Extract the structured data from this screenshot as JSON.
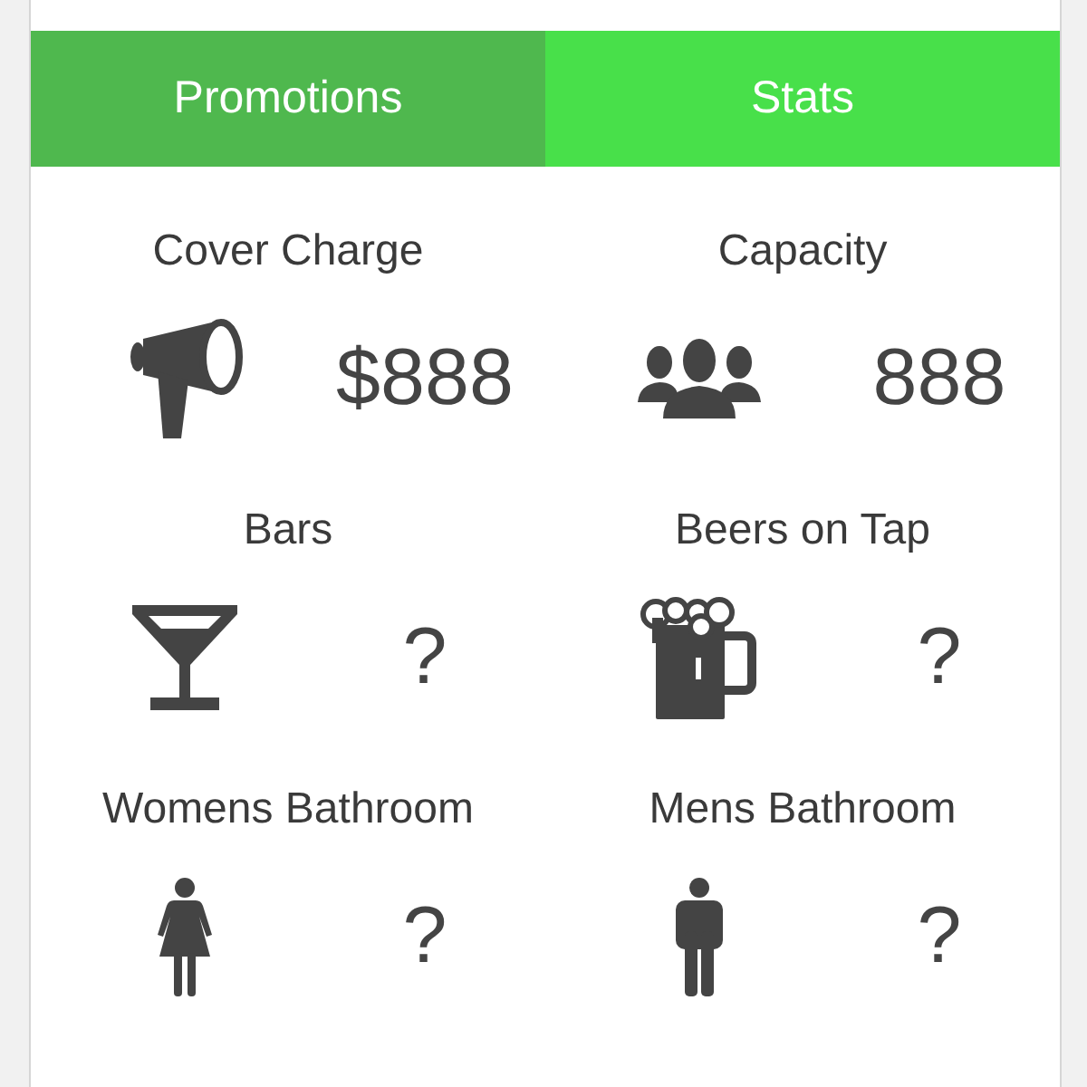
{
  "tabs": [
    {
      "label": "Promotions",
      "selected": false
    },
    {
      "label": "Stats",
      "selected": true
    }
  ],
  "stats": [
    {
      "label": "Cover Charge",
      "value": "$888"
    },
    {
      "label": "Capacity",
      "value": "888"
    },
    {
      "label": "Bars",
      "value": "?"
    },
    {
      "label": "Beers on Tap",
      "value": "?"
    },
    {
      "label": "Womens Bathroom",
      "value": "?"
    },
    {
      "label": "Mens Bathroom",
      "value": "?"
    }
  ]
}
